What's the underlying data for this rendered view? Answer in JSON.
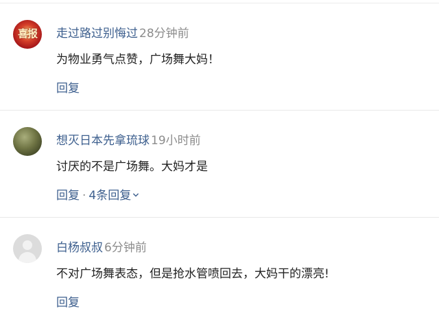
{
  "comments": [
    {
      "username": "走过路过别悔过",
      "time": "28分钟前",
      "text": "为物业勇气点赞，广场舞大妈！",
      "reply_label": "回复",
      "avatar_text": "喜报"
    },
    {
      "username": "想灭日本先拿琉球",
      "time": "19小时前",
      "text": "讨厌的不是广场舞。大妈才是",
      "reply_label": "回复",
      "separator": "·",
      "replies_label": "4条回复"
    },
    {
      "username": "白杨叔叔",
      "time": "6分钟前",
      "text": "不对广场舞表态，但是抢水管喷回去，大妈干的漂亮!",
      "reply_label": "回复"
    }
  ],
  "colors": {
    "username": "#3d5f8e",
    "time": "#8c8c8c",
    "text": "#222222",
    "divider": "#e8e8e8"
  },
  "icons": [
    "chevron-down-icon",
    "default-avatar-icon"
  ]
}
